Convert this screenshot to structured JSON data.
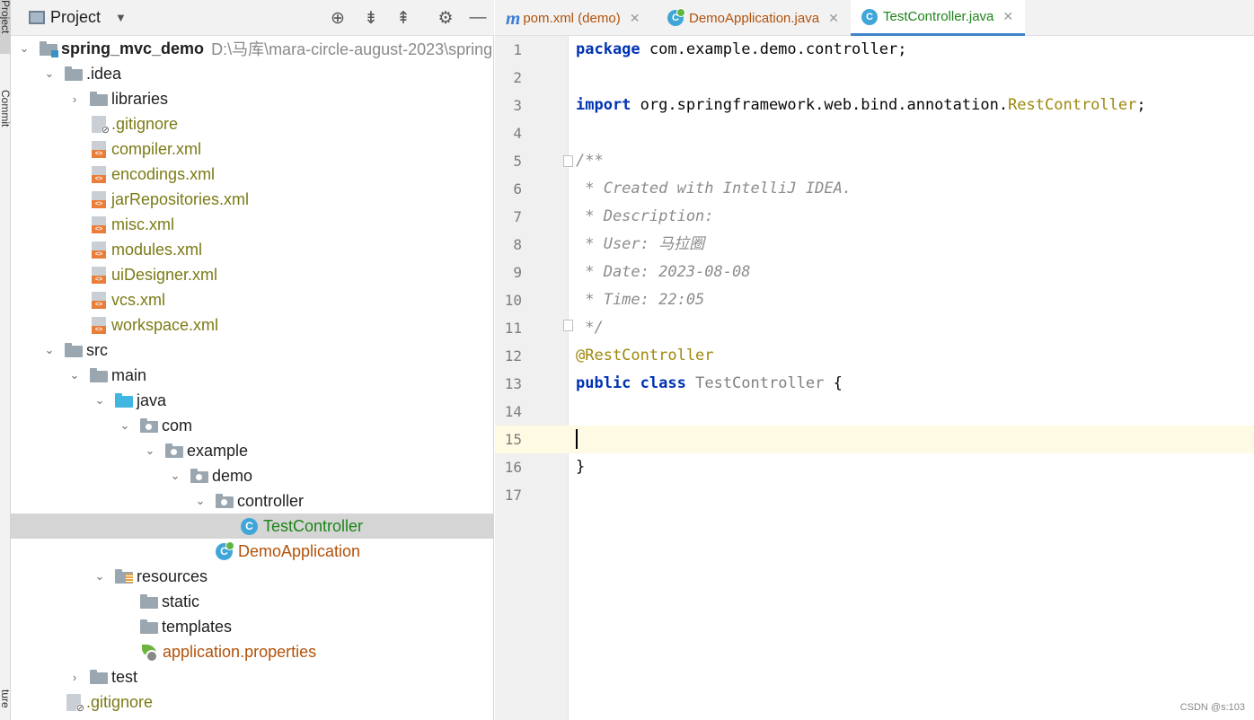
{
  "side_strip": {
    "commit_label": "Commit",
    "project_label": "Project",
    "structure_label": "ture"
  },
  "project_panel": {
    "title": "Project",
    "header_icons": [
      "crosshair-icon",
      "expand-all-icon",
      "collapse-all-icon",
      "gear-icon",
      "minimize-icon"
    ]
  },
  "tree": [
    {
      "label": "spring_mvc_demo",
      "path": "D:\\马库\\mara-circle-august-2023\\spring",
      "icon": "module-folder-icon",
      "expanded": true
    },
    {
      "label": ".idea",
      "icon": "folder-icon",
      "expanded": true
    },
    {
      "label": "libraries",
      "icon": "folder-icon",
      "expanded": false
    },
    {
      "label": ".gitignore",
      "icon": "ignored-file-icon"
    },
    {
      "label": "compiler.xml",
      "icon": "xml-file-icon"
    },
    {
      "label": "encodings.xml",
      "icon": "xml-file-icon"
    },
    {
      "label": "jarRepositories.xml",
      "icon": "xml-file-icon"
    },
    {
      "label": "misc.xml",
      "icon": "xml-file-icon"
    },
    {
      "label": "modules.xml",
      "icon": "xml-file-icon"
    },
    {
      "label": "uiDesigner.xml",
      "icon": "xml-file-icon"
    },
    {
      "label": "vcs.xml",
      "icon": "xml-file-icon"
    },
    {
      "label": "workspace.xml",
      "icon": "xml-file-icon"
    },
    {
      "label": "src",
      "icon": "folder-icon",
      "expanded": true
    },
    {
      "label": "main",
      "icon": "folder-icon",
      "expanded": true
    },
    {
      "label": "java",
      "icon": "source-folder-icon",
      "expanded": true
    },
    {
      "label": "com",
      "icon": "package-icon",
      "expanded": true
    },
    {
      "label": "example",
      "icon": "package-icon",
      "expanded": true
    },
    {
      "label": "demo",
      "icon": "package-icon",
      "expanded": true
    },
    {
      "label": "controller",
      "icon": "package-icon",
      "expanded": true
    },
    {
      "label": "TestController",
      "icon": "class-icon",
      "selected": true
    },
    {
      "label": "DemoApplication",
      "icon": "spring-boot-class-icon"
    },
    {
      "label": "resources",
      "icon": "resources-folder-icon",
      "expanded": true
    },
    {
      "label": "static",
      "icon": "folder-icon"
    },
    {
      "label": "templates",
      "icon": "folder-icon"
    },
    {
      "label": "application.properties",
      "icon": "spring-properties-icon"
    },
    {
      "label": "test",
      "icon": "folder-icon",
      "expanded": false
    },
    {
      "label": ".gitignore",
      "icon": "ignored-file-icon"
    }
  ],
  "tabs": [
    {
      "label": "pom.xml (demo)",
      "icon": "maven-icon",
      "active": false,
      "color": "#b2520a"
    },
    {
      "label": "DemoApplication.java",
      "icon": "spring-boot-class-icon",
      "active": false,
      "color": "#b2520a"
    },
    {
      "label": "TestController.java",
      "icon": "class-icon",
      "active": true,
      "color": "#1d8419"
    }
  ],
  "editor": {
    "line_numbers": [
      "1",
      "2",
      "3",
      "4",
      "5",
      "6",
      "7",
      "8",
      "9",
      "10",
      "11",
      "12",
      "13",
      "14",
      "15",
      "16",
      "17"
    ],
    "current_line": 15,
    "code": {
      "l1_kw": "package",
      "l1_rest": " com.example.demo.controller;",
      "l3_kw": "import",
      "l3_pkg": " org.springframework.web.bind.annotation.",
      "l3_cls": "RestController",
      "l3_end": ";",
      "l5": "/**",
      "l6": " * Created with IntelliJ IDEA.",
      "l7": " * Description:",
      "l8": " * User: 马拉圈",
      "l9": " * Date: 2023-08-08",
      "l10": " * Time: 22:05",
      "l11": " */",
      "l12": "@RestController",
      "l13_kw1": "public",
      "l13_kw2": "class",
      "l13_name": "TestController",
      "l13_brace": "{",
      "l16": "}"
    }
  },
  "watermark": "CSDN @s:103",
  "colors": {
    "accent": "#4083c9",
    "keyword": "#0033b3",
    "annotation": "#9e880d",
    "comment": "#8c8c8c",
    "selection": "#d5d5d5",
    "current_line": "#fefae3"
  }
}
